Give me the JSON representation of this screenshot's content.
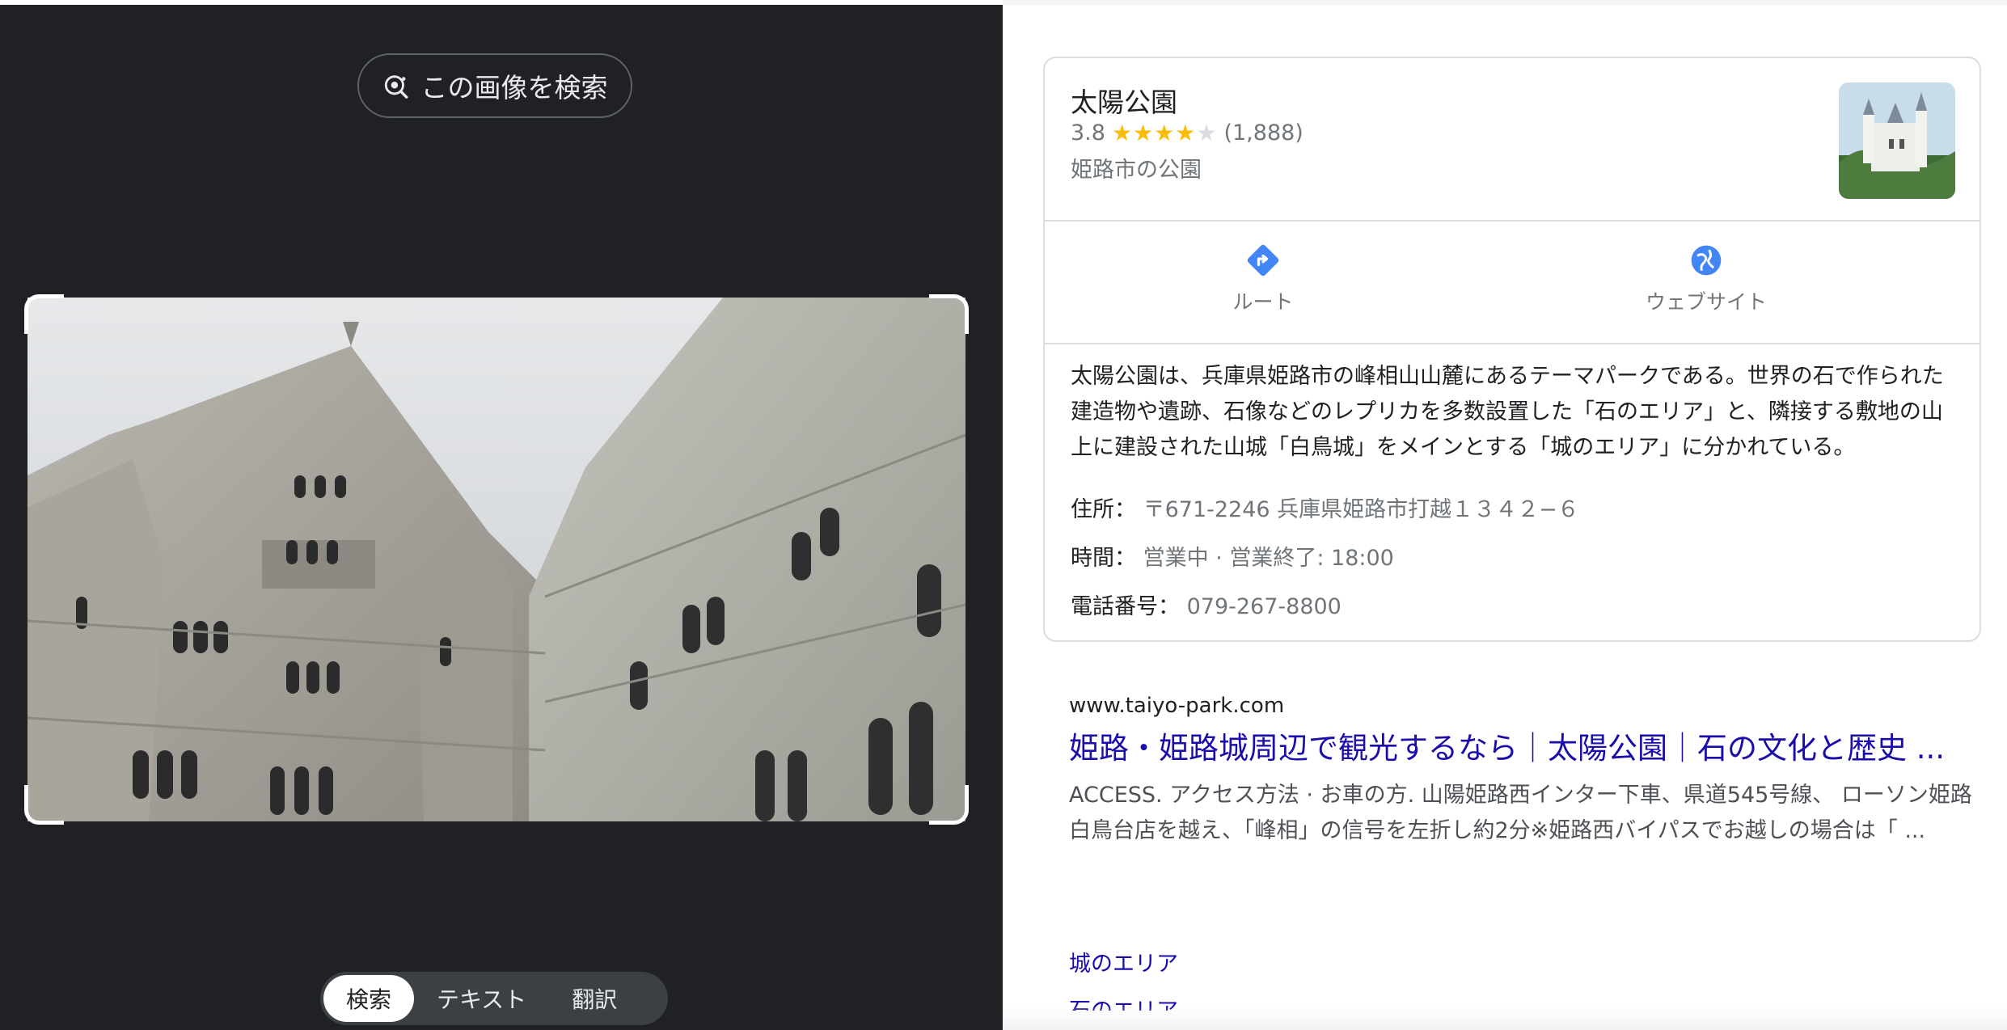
{
  "left_panel": {
    "search_image_label": "この画像を検索",
    "modes": [
      "検索",
      "テキスト",
      "翻訳"
    ],
    "active_mode": "検索"
  },
  "knowledge_panel": {
    "title": "太陽公園",
    "rating": "3.8",
    "rating_value": 3.8,
    "review_count": "(1,888)",
    "type": "姫路市の公園",
    "actions": {
      "route": "ルート",
      "website": "ウェブサイト"
    },
    "description": "太陽公園は、兵庫県姫路市の峰相山山麓にあるテーマパークである。世界の石で作られた建造物や遺跡、石像などのレプリカを多数設置した「石のエリア」と、隣接する敷地の山上に建設された山城「白鳥城」をメインとする「城のエリア」に分かれている。",
    "address_label": "住所：",
    "address_value": "〒671-2246 兵庫県姫路市打越１３４２−６",
    "hours_label": "時間：",
    "hours_value": "営業中 · 営業終了: 18:00",
    "phone_label": "電話番号：",
    "phone_value": "079-267-8800"
  },
  "result": {
    "url": "www.taiyo-park.com",
    "title": "姫路・姫路城周辺で観光するなら｜太陽公園｜石の文化と歴史 ...",
    "snippet": "ACCESS. アクセス方法 · お車の方. 山陽姫路西インター下車、県道545号線、 ローソン姫路白鳥台店を越え、「峰相」の信号を左折し約2分※姫路西バイパスでお越しの場合は「 ...",
    "sitelinks": [
      "城のエリア",
      "石のエリア"
    ]
  },
  "colors": {
    "dark_bg": "#202124",
    "link": "#1a0dab",
    "star": "#fbbc04",
    "accent_blue": "#4285f4"
  }
}
